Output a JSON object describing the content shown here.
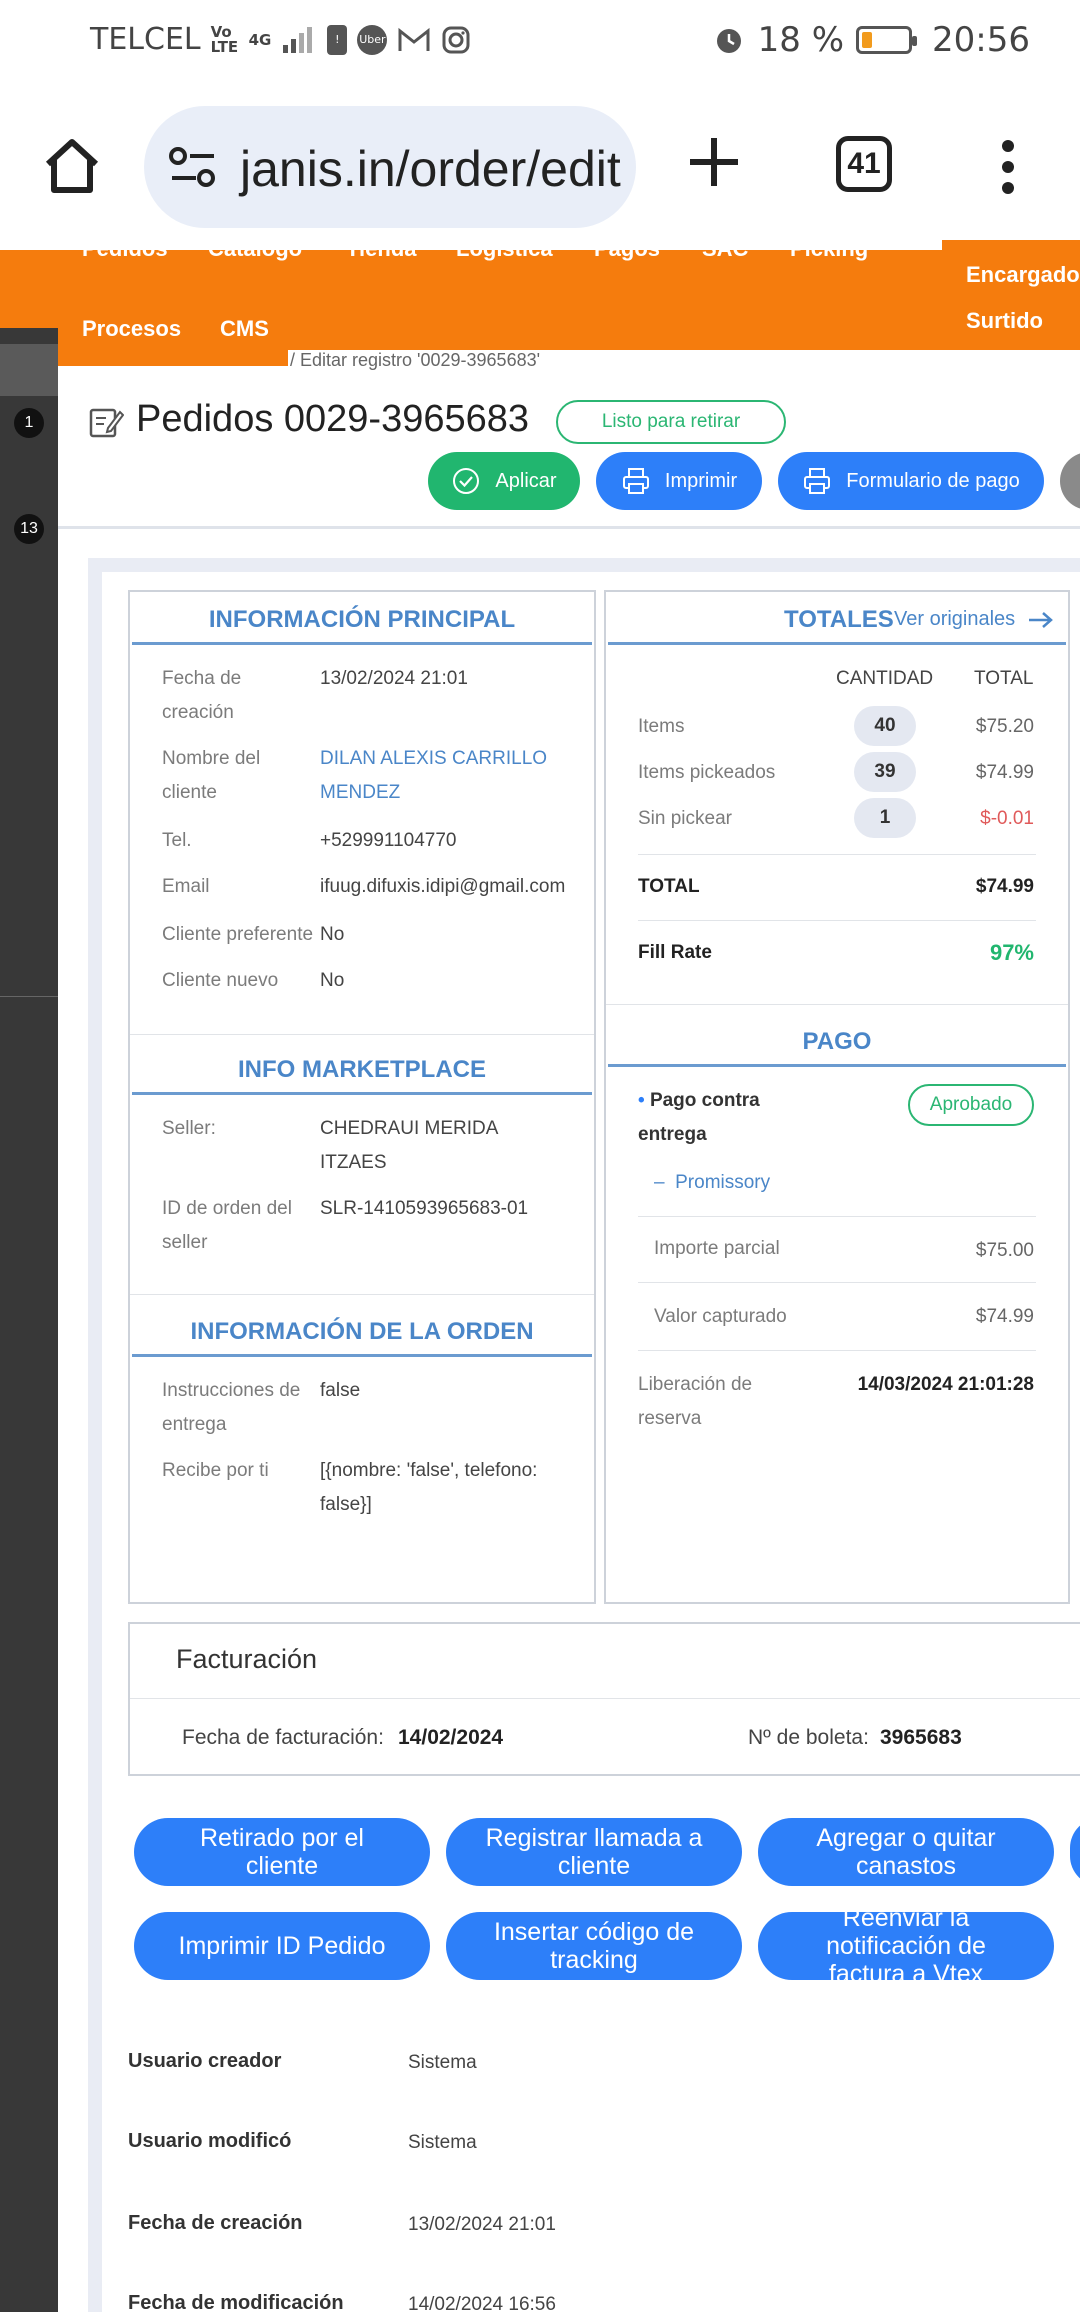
{
  "status_bar": {
    "carrier": "TELCEL",
    "volte": "Vo LTE",
    "network": "4G",
    "battery": "18 %",
    "time": "20:56",
    "icons": [
      "alert-icon",
      "uber-icon",
      "gmail-icon",
      "instagram-icon",
      "alarm-icon",
      "battery-icon"
    ]
  },
  "browser": {
    "url": "janis.in/order/edit",
    "tab_count": "41"
  },
  "nav": {
    "items": [
      "Pedidos",
      "Catálogo",
      "Tienda",
      "Logística",
      "Pagos",
      "SAC",
      "Picking"
    ],
    "row2": [
      "Procesos",
      "CMS"
    ],
    "right_label_line1": "Encargado C",
    "right_label_line2": "Surtido"
  },
  "sidebar": {
    "badges": [
      "1",
      "13"
    ]
  },
  "breadcrumb": "/ Editar registro '0029-3965683'",
  "header": {
    "title": "Pedidos 0029-3965683",
    "status": "Listo para retirar",
    "buttons": {
      "apply": "Aplicar",
      "print": "Imprimir",
      "payment_form": "Formulario de pago"
    }
  },
  "info_principal": {
    "title": "INFORMACIÓN PRINCIPAL",
    "rows": [
      {
        "label": "Fecha de creación",
        "value": "13/02/2024 21:01"
      },
      {
        "label": "Nombre del cliente",
        "value": "DILAN ALEXIS CARRILLO MENDEZ"
      },
      {
        "label": "Tel.",
        "value": "+529991104770"
      },
      {
        "label": "Email",
        "value": "ifuug.difuxis.idipi@gmail.com"
      },
      {
        "label": "Cliente preferente",
        "value": "No"
      },
      {
        "label": "Cliente nuevo",
        "value": "No"
      }
    ]
  },
  "info_marketplace": {
    "title": "INFO MARKETPLACE",
    "rows": [
      {
        "label": "Seller:",
        "value": "CHEDRAUI MERIDA ITZAES"
      },
      {
        "label": "ID de orden del seller",
        "value": "SLR-1410593965683-01"
      }
    ]
  },
  "info_orden": {
    "title": "INFORMACIÓN DE LA ORDEN",
    "rows": [
      {
        "label": "Instrucciones de entrega",
        "value": "false"
      },
      {
        "label": "Recibe por ti",
        "value": "[{nombre: 'false', telefono: false}]"
      }
    ]
  },
  "totales": {
    "title": "TOTALES",
    "link": "Ver originales",
    "col_qty": "CANTIDAD",
    "col_total": "TOTAL",
    "rows": [
      {
        "label": "Items",
        "qty": "40",
        "total": "$75.20"
      },
      {
        "label": "Items pickeados",
        "qty": "39",
        "total": "$74.99"
      },
      {
        "label": "Sin pickear",
        "qty": "1",
        "total": "$-0.01"
      }
    ],
    "total_label": "TOTAL",
    "total_value": "$74.99",
    "fill_rate_label": "Fill Rate",
    "fill_rate_value": "97%",
    "negative_color": "#e05a5a",
    "fill_color": "#21b66f"
  },
  "pago": {
    "title": "PAGO",
    "method": "Pago contra entrega",
    "status": "Aprobado",
    "sub_method": "Promissory",
    "importe_label": "Importe parcial",
    "importe_value": "$75.00",
    "capturado_label": "Valor capturado",
    "capturado_value": "$74.99",
    "liberacion_label": "Liberación de reserva",
    "liberacion_value": "14/03/2024 21:01:28"
  },
  "facturacion": {
    "title": "Facturación",
    "fecha_label": "Fecha de facturación:",
    "fecha_value": "14/02/2024",
    "boleta_label": "Nº de boleta:",
    "boleta_value": "3965683"
  },
  "actions": [
    "Retirado por el cliente",
    "Registrar llamada a cliente",
    "Agregar o quitar canastos",
    "Imprimir ID Pedido",
    "Insertar código de tracking",
    "Reenviar la notificación de factura a Vtex"
  ],
  "meta": [
    {
      "label": "Usuario creador",
      "value": "Sistema"
    },
    {
      "label": "Usuario modificó",
      "value": "Sistema"
    },
    {
      "label": "Fecha de creación",
      "value": "13/02/2024 21:01"
    },
    {
      "label": "Fecha de modificación",
      "value": "14/02/2024 16:56"
    }
  ],
  "colors": {
    "brand_orange": "#f57c0d",
    "primary_blue": "#2d7ff9",
    "success_green": "#21b66f",
    "section_blue": "#4a86c8"
  }
}
